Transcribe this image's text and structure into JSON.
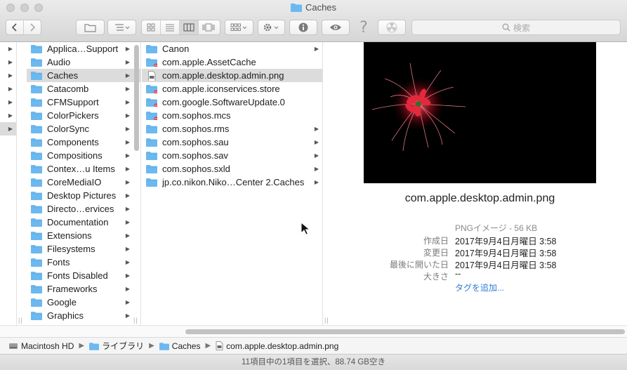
{
  "window": {
    "title": "Caches"
  },
  "toolbar": {
    "search_placeholder": "検索",
    "icons": [
      "back-icon",
      "forward-icon",
      "new-folder-icon",
      "list-menu-icon",
      "icon-view-icon",
      "list-view-icon",
      "column-view-icon",
      "cover-flow-icon",
      "arrange-icon",
      "gear-icon",
      "info-icon",
      "eye-icon",
      "help-icon",
      "radiation-icon"
    ]
  },
  "col1": {
    "arrow": "▶"
  },
  "col2": {
    "items": [
      {
        "name": "Applica…Support",
        "arrow": "▶"
      },
      {
        "name": "Audio",
        "arrow": "▶"
      },
      {
        "name": "Caches",
        "arrow": "▶"
      },
      {
        "name": "Catacomb",
        "arrow": "▶"
      },
      {
        "name": "CFMSupport",
        "arrow": "▶"
      },
      {
        "name": "ColorPickers",
        "arrow": "▶"
      },
      {
        "name": "ColorSync",
        "arrow": "▶"
      },
      {
        "name": "Components",
        "arrow": "▶"
      },
      {
        "name": "Compositions",
        "arrow": "▶"
      },
      {
        "name": "Contex…u Items",
        "arrow": "▶"
      },
      {
        "name": "CoreMediaIO",
        "arrow": "▶"
      },
      {
        "name": "Desktop Pictures",
        "arrow": "▶"
      },
      {
        "name": "Directo…ervices",
        "arrow": "▶"
      },
      {
        "name": "Documentation",
        "arrow": "▶"
      },
      {
        "name": "Extensions",
        "arrow": "▶"
      },
      {
        "name": "Filesystems",
        "arrow": "▶"
      },
      {
        "name": "Fonts",
        "arrow": "▶"
      },
      {
        "name": "Fonts Disabled",
        "arrow": "▶"
      },
      {
        "name": "Frameworks",
        "arrow": "▶"
      },
      {
        "name": "Google",
        "arrow": "▶"
      },
      {
        "name": "Graphics",
        "arrow": "▶"
      }
    ]
  },
  "col3": {
    "items": [
      {
        "name": "Canon",
        "arrow": "▶",
        "kind": "folder"
      },
      {
        "name": "com.apple.AssetCache",
        "arrow": "",
        "kind": "folder-locked"
      },
      {
        "name": "com.apple.desktop.admin.png",
        "arrow": "",
        "kind": "file"
      },
      {
        "name": "com.apple.iconservices.store",
        "arrow": "",
        "kind": "folder-locked"
      },
      {
        "name": "com.google.SoftwareUpdate.0",
        "arrow": "",
        "kind": "folder-locked"
      },
      {
        "name": "com.sophos.mcs",
        "arrow": "",
        "kind": "folder-locked"
      },
      {
        "name": "com.sophos.rms",
        "arrow": "▶",
        "kind": "folder"
      },
      {
        "name": "com.sophos.sau",
        "arrow": "▶",
        "kind": "folder"
      },
      {
        "name": "com.sophos.sav",
        "arrow": "▶",
        "kind": "folder"
      },
      {
        "name": "com.sophos.sxld",
        "arrow": "▶",
        "kind": "folder"
      },
      {
        "name": "jp.co.nikon.Niko…Center 2.Caches",
        "arrow": "▶",
        "kind": "folder"
      }
    ]
  },
  "preview": {
    "filename": "com.apple.desktop.admin.png",
    "kind_size": "PNGイメージ - 56 KB",
    "created_label": "作成日",
    "created_value": "2017年9月4日月曜日 3:58",
    "modified_label": "変更日",
    "modified_value": "2017年9月4日月曜日 3:58",
    "opened_label": "最後に開いた日",
    "opened_value": "2017年9月4日月曜日 3:58",
    "size_label": "大きさ",
    "size_value": "--",
    "add_tags": "タグを追加..."
  },
  "pathbar": {
    "items": [
      "Macintosh HD",
      "ライブラリ",
      "Caches",
      "com.apple.desktop.admin.png"
    ],
    "separator": "▶"
  },
  "status": {
    "text": "11項目中の1項目を選択、88.74 GB空き"
  },
  "colors": {
    "folder_blue": "#6cb9ef",
    "selection": "#dcdcdc",
    "link_blue": "#2f7bd8"
  }
}
